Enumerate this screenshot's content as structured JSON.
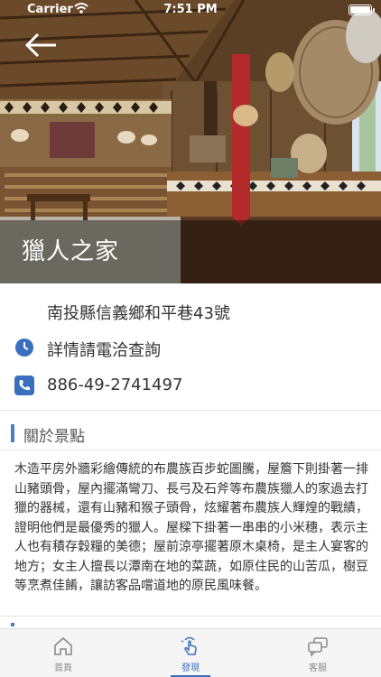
{
  "status_bar": {
    "carrier": "Carrier",
    "time": "7:51 PM"
  },
  "place": {
    "title": "獵人之家",
    "address": "南投縣信義鄉和平巷43號",
    "hours": "詳情請電洽查詢",
    "phone": "886-49-2741497"
  },
  "about": {
    "heading": "關於景點",
    "description": "木造平房外牆彩繪傳統的布農族百步蛇圖騰，屋簷下則掛著一排山豬頭骨，屋內擺滿彎刀、長弓及石斧等布農族獵人的家過去打獵的器械，還有山豬和猴子頭骨，炫耀著布農族人輝煌的戰績，證明他們是最優秀的獵人。屋樑下掛著一串串的小米穗，表示主人也有積存穀糧的美德；屋前涼亭擺著原木桌椅，是主人宴客的地方；女主人擅長以潭南在地的菜蔬，如原住民的山苦瓜，樹豆等烹煮佳餚，讓訪客品嚐道地的原民風味餐。"
  },
  "tabs": [
    {
      "label": "首頁",
      "icon": "home-icon"
    },
    {
      "label": "發現",
      "icon": "touch-icon"
    },
    {
      "label": "客服",
      "icon": "chat-icon"
    }
  ],
  "colors": {
    "accent": "#3a6fbf",
    "section_bar": "#4a7ec9"
  }
}
